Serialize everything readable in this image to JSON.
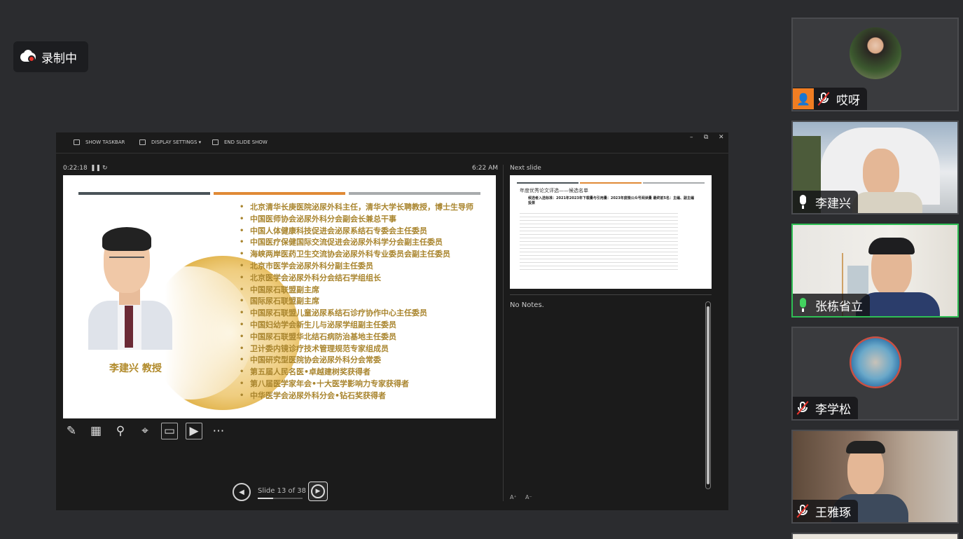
{
  "recording": {
    "label": "录制中"
  },
  "presenter": {
    "toolbar": {
      "show_taskbar": "SHOW TASKBAR",
      "display_settings": "DISPLAY SETTINGS ▾",
      "end_slide_show": "END SLIDE SHOW"
    },
    "window_controls": {
      "minimize": "–",
      "restore": "⧉",
      "close": "✕"
    },
    "timer": "0:22:18",
    "time": "6:22 AM",
    "slide": {
      "name": "李建兴  教授",
      "bar_colors": [
        "#4a5358",
        "#e08a36",
        "#a8abad"
      ],
      "bullets": [
        "北京清华长庚医院泌尿外科主任，清华大学长聘教授，博士生导师",
        "中国医师协会泌尿外科分会副会长兼总干事",
        "中国人体健康科技促进会泌尿系结石专委会主任委员",
        "中国医疗保健国际交流促进会泌尿外科学分会副主任委员",
        "海峡两岸医药卫生交流协会泌尿外科专业委员会副主任委员",
        "北京市医学会泌尿外科分副主任委员",
        "北京医学会泌尿外科分会结石学组组长",
        "中国尿石联盟副主席",
        "国际尿石联盟副主席",
        "中国尿石联盟儿童泌尿系结石诊疗协作中心主任委员",
        "中国妇幼学会新生儿与泌尿学组副主任委员",
        "中国尿石联盟华北结石病防治基地主任委员",
        "卫计委内镜诊疗技术管理规范专家组成员",
        "中国研究型医院协会泌尿外科分会常委",
        "第五届人民名医•卓越建树奖获得者",
        "第八届医学家年会•十大医学影响力专家获得者",
        "中华医学会泌尿外科分会•钻石奖获得者"
      ]
    },
    "slide_counter": "Slide 13 of 38",
    "slide_progress": 0.34,
    "next_slide_label": "Next slide",
    "next_slide": {
      "title": "年度优秀论文评选——候选名单",
      "subtitle": "候选者入选标准：2021年2023年下载量与引用量：2023年度微公众号阅读量 最终前5名：主编、副主编投票"
    },
    "notes": "No Notes.",
    "font_controls": {
      "increase": "A⁺",
      "decrease": "A⁻"
    }
  },
  "participants": [
    {
      "name": "哎呀",
      "mic": "muted",
      "host": true
    },
    {
      "name": "李建兴",
      "mic": "on"
    },
    {
      "name": "张栋省立",
      "mic": "speaking",
      "active": true
    },
    {
      "name": "李学松",
      "mic": "muted"
    },
    {
      "name": "王雅琢",
      "mic": "muted"
    }
  ],
  "colors": {
    "background": "#2b2c2f",
    "accent_gold": "#a9852e",
    "speaking_green": "#2fbf55",
    "record_red": "#e8332b",
    "host_orange": "#f07d22"
  },
  "icons": {
    "tools": [
      "pen-icon",
      "slides-grid-icon",
      "zoom-icon",
      "laser-pointer-icon",
      "subtitles-icon",
      "camera-icon",
      "more-options-icon"
    ]
  }
}
